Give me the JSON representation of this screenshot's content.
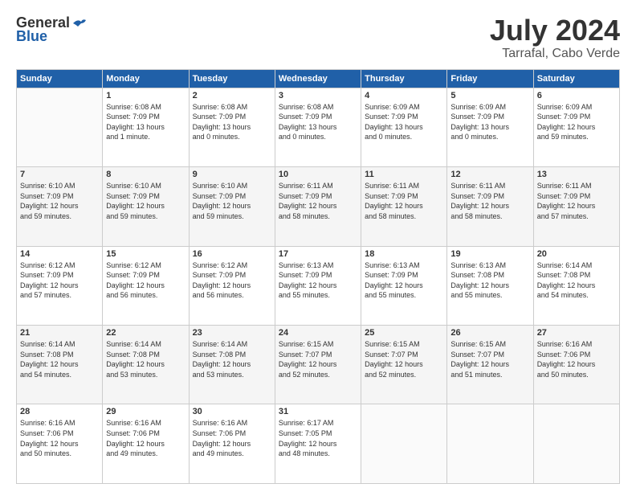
{
  "header": {
    "logo_general": "General",
    "logo_blue": "Blue",
    "month": "July 2024",
    "location": "Tarrafal, Cabo Verde"
  },
  "weekdays": [
    "Sunday",
    "Monday",
    "Tuesday",
    "Wednesday",
    "Thursday",
    "Friday",
    "Saturday"
  ],
  "weeks": [
    [
      {
        "day": "",
        "info": ""
      },
      {
        "day": "1",
        "info": "Sunrise: 6:08 AM\nSunset: 7:09 PM\nDaylight: 13 hours\nand 1 minute."
      },
      {
        "day": "2",
        "info": "Sunrise: 6:08 AM\nSunset: 7:09 PM\nDaylight: 13 hours\nand 0 minutes."
      },
      {
        "day": "3",
        "info": "Sunrise: 6:08 AM\nSunset: 7:09 PM\nDaylight: 13 hours\nand 0 minutes."
      },
      {
        "day": "4",
        "info": "Sunrise: 6:09 AM\nSunset: 7:09 PM\nDaylight: 13 hours\nand 0 minutes."
      },
      {
        "day": "5",
        "info": "Sunrise: 6:09 AM\nSunset: 7:09 PM\nDaylight: 13 hours\nand 0 minutes."
      },
      {
        "day": "6",
        "info": "Sunrise: 6:09 AM\nSunset: 7:09 PM\nDaylight: 12 hours\nand 59 minutes."
      }
    ],
    [
      {
        "day": "7",
        "info": "Sunrise: 6:10 AM\nSunset: 7:09 PM\nDaylight: 12 hours\nand 59 minutes."
      },
      {
        "day": "8",
        "info": "Sunrise: 6:10 AM\nSunset: 7:09 PM\nDaylight: 12 hours\nand 59 minutes."
      },
      {
        "day": "9",
        "info": "Sunrise: 6:10 AM\nSunset: 7:09 PM\nDaylight: 12 hours\nand 59 minutes."
      },
      {
        "day": "10",
        "info": "Sunrise: 6:11 AM\nSunset: 7:09 PM\nDaylight: 12 hours\nand 58 minutes."
      },
      {
        "day": "11",
        "info": "Sunrise: 6:11 AM\nSunset: 7:09 PM\nDaylight: 12 hours\nand 58 minutes."
      },
      {
        "day": "12",
        "info": "Sunrise: 6:11 AM\nSunset: 7:09 PM\nDaylight: 12 hours\nand 58 minutes."
      },
      {
        "day": "13",
        "info": "Sunrise: 6:11 AM\nSunset: 7:09 PM\nDaylight: 12 hours\nand 57 minutes."
      }
    ],
    [
      {
        "day": "14",
        "info": "Sunrise: 6:12 AM\nSunset: 7:09 PM\nDaylight: 12 hours\nand 57 minutes."
      },
      {
        "day": "15",
        "info": "Sunrise: 6:12 AM\nSunset: 7:09 PM\nDaylight: 12 hours\nand 56 minutes."
      },
      {
        "day": "16",
        "info": "Sunrise: 6:12 AM\nSunset: 7:09 PM\nDaylight: 12 hours\nand 56 minutes."
      },
      {
        "day": "17",
        "info": "Sunrise: 6:13 AM\nSunset: 7:09 PM\nDaylight: 12 hours\nand 55 minutes."
      },
      {
        "day": "18",
        "info": "Sunrise: 6:13 AM\nSunset: 7:09 PM\nDaylight: 12 hours\nand 55 minutes."
      },
      {
        "day": "19",
        "info": "Sunrise: 6:13 AM\nSunset: 7:08 PM\nDaylight: 12 hours\nand 55 minutes."
      },
      {
        "day": "20",
        "info": "Sunrise: 6:14 AM\nSunset: 7:08 PM\nDaylight: 12 hours\nand 54 minutes."
      }
    ],
    [
      {
        "day": "21",
        "info": "Sunrise: 6:14 AM\nSunset: 7:08 PM\nDaylight: 12 hours\nand 54 minutes."
      },
      {
        "day": "22",
        "info": "Sunrise: 6:14 AM\nSunset: 7:08 PM\nDaylight: 12 hours\nand 53 minutes."
      },
      {
        "day": "23",
        "info": "Sunrise: 6:14 AM\nSunset: 7:08 PM\nDaylight: 12 hours\nand 53 minutes."
      },
      {
        "day": "24",
        "info": "Sunrise: 6:15 AM\nSunset: 7:07 PM\nDaylight: 12 hours\nand 52 minutes."
      },
      {
        "day": "25",
        "info": "Sunrise: 6:15 AM\nSunset: 7:07 PM\nDaylight: 12 hours\nand 52 minutes."
      },
      {
        "day": "26",
        "info": "Sunrise: 6:15 AM\nSunset: 7:07 PM\nDaylight: 12 hours\nand 51 minutes."
      },
      {
        "day": "27",
        "info": "Sunrise: 6:16 AM\nSunset: 7:06 PM\nDaylight: 12 hours\nand 50 minutes."
      }
    ],
    [
      {
        "day": "28",
        "info": "Sunrise: 6:16 AM\nSunset: 7:06 PM\nDaylight: 12 hours\nand 50 minutes."
      },
      {
        "day": "29",
        "info": "Sunrise: 6:16 AM\nSunset: 7:06 PM\nDaylight: 12 hours\nand 49 minutes."
      },
      {
        "day": "30",
        "info": "Sunrise: 6:16 AM\nSunset: 7:06 PM\nDaylight: 12 hours\nand 49 minutes."
      },
      {
        "day": "31",
        "info": "Sunrise: 6:17 AM\nSunset: 7:05 PM\nDaylight: 12 hours\nand 48 minutes."
      },
      {
        "day": "",
        "info": ""
      },
      {
        "day": "",
        "info": ""
      },
      {
        "day": "",
        "info": ""
      }
    ]
  ]
}
